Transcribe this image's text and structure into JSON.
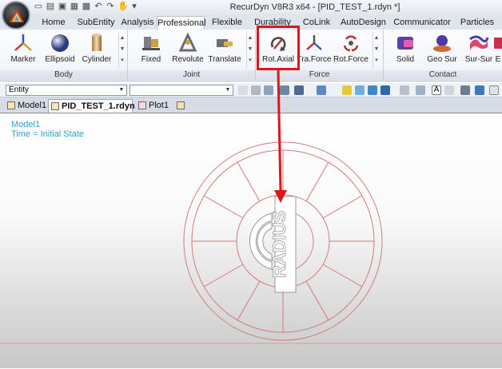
{
  "window": {
    "title": "RecurDyn V8R3 x64 - [PID_TEST_1.rdyn *]"
  },
  "ribbon_tabs": [
    {
      "label": "Home",
      "active": false
    },
    {
      "label": "SubEntity",
      "active": false
    },
    {
      "label": "Analysis",
      "active": false
    },
    {
      "label": "Professional",
      "active": true
    },
    {
      "label": "Flexible",
      "active": false
    },
    {
      "label": "Durability",
      "active": false
    },
    {
      "label": "CoLink",
      "active": false
    },
    {
      "label": "AutoDesign",
      "active": false
    },
    {
      "label": "Communicator",
      "active": false
    },
    {
      "label": "Particles",
      "active": false
    }
  ],
  "groups": {
    "body": {
      "label": "Body",
      "buttons": [
        "Marker",
        "Ellipsoid",
        "Cylinder"
      ]
    },
    "joint": {
      "label": "Joint",
      "buttons": [
        "Fixed",
        "Revolute",
        "Translate"
      ]
    },
    "force": {
      "label": "Force",
      "buttons": [
        "Rot.Axial",
        "Tra.Force",
        "Rot.Force"
      ]
    },
    "contact": {
      "label": "Contact",
      "buttons": [
        "Solid",
        "Geo Sur",
        "Sur-Sur",
        "E"
      ]
    }
  },
  "toolbar": {
    "entity_value": "Entity"
  },
  "doc_tabs": [
    {
      "label": "Model1",
      "active": false
    },
    {
      "label": "PID_TEST_1.rdyn",
      "active": true,
      "close": "✕"
    },
    {
      "label": "Plot1",
      "active": false
    }
  ],
  "viewport": {
    "model_name": "Model1",
    "time_text": "Time  =  Initial State",
    "marker_text": "RADIUS"
  },
  "colors": {
    "highlight": "#e0151a",
    "info_text": "#2fa1c9",
    "wheel": "#d47a7a"
  },
  "icons": {
    "marker": "marker-icon",
    "ellipsoid": "ellipsoid-icon",
    "cylinder": "cylinder-icon",
    "fixed": "fixed-joint-icon",
    "revolute": "revolute-joint-icon",
    "translate": "translate-joint-icon",
    "rot_axial": "rot-axial-icon",
    "tra_force": "tra-force-icon",
    "rot_force": "rot-force-icon",
    "solid": "solid-contact-icon",
    "geo_sur": "geo-surface-icon",
    "sur_sur": "surface-surface-icon"
  }
}
